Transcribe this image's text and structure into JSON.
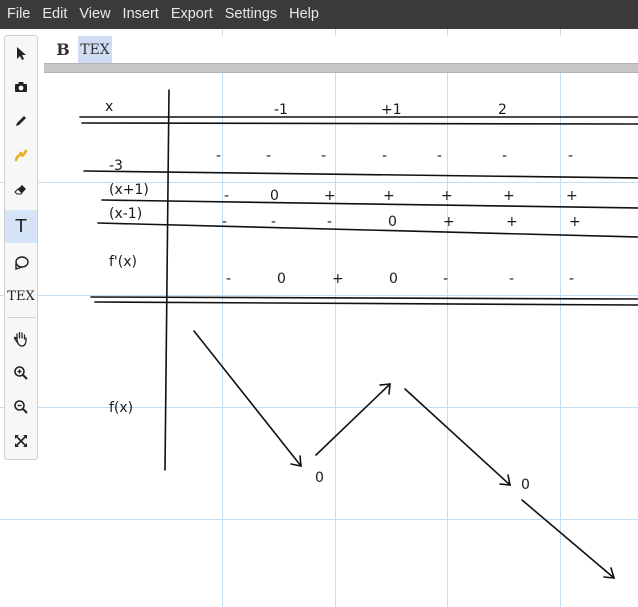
{
  "menu": [
    "File",
    "Edit",
    "View",
    "Insert",
    "Export",
    "Settings",
    "Help"
  ],
  "tools": [
    {
      "name": "select-tool",
      "icon": "cursor-arrow-icon"
    },
    {
      "name": "screenshot-tool",
      "icon": "camera-icon"
    },
    {
      "name": "pen-tool",
      "icon": "pen-icon"
    },
    {
      "name": "highlighter-tool",
      "icon": "highlighter-icon"
    },
    {
      "name": "eraser-tool",
      "icon": "eraser-icon"
    },
    {
      "name": "text-tool",
      "icon": "text-icon",
      "label": "T",
      "active": true
    },
    {
      "name": "shape-tool",
      "icon": "lasso-shape-icon"
    },
    {
      "name": "latex-tool",
      "icon": "tex-icon",
      "label": "TEX"
    },
    {
      "name": "pan-tool",
      "icon": "hand-icon"
    },
    {
      "name": "zoom-in-tool",
      "icon": "zoom-in-icon"
    },
    {
      "name": "zoom-out-tool",
      "icon": "zoom-out-icon"
    },
    {
      "name": "fit-screen-tool",
      "icon": "expand-icon"
    }
  ],
  "text_toolbar": {
    "bold_label": "B",
    "tex_label": "TEX",
    "tex_active": true
  },
  "sign_table": {
    "x_label": "x",
    "x_values": [
      "-1",
      "+1",
      "2"
    ],
    "rows": [
      {
        "label": "-3",
        "signs": [
          "-",
          "-",
          "-",
          "-",
          "-",
          "-",
          "-"
        ]
      },
      {
        "label": "(x+1)",
        "signs": [
          "-",
          "0",
          "+",
          "+",
          "+",
          "+",
          "+"
        ]
      },
      {
        "label": "(x-1)",
        "signs": [
          "-",
          "-",
          "-",
          "0",
          "+",
          "+",
          "+"
        ]
      },
      {
        "label": "f'(x)",
        "signs": [
          "-",
          "0",
          "+",
          "0",
          "-",
          "-",
          "-"
        ]
      }
    ],
    "fx_label": "f(x)",
    "extremum_values": [
      "0",
      "0"
    ]
  },
  "colors": {
    "menubar": "#3b3b3b",
    "grid": "#c6ddf0",
    "ink": "#111111",
    "active_tool": "#d6e4f7"
  }
}
